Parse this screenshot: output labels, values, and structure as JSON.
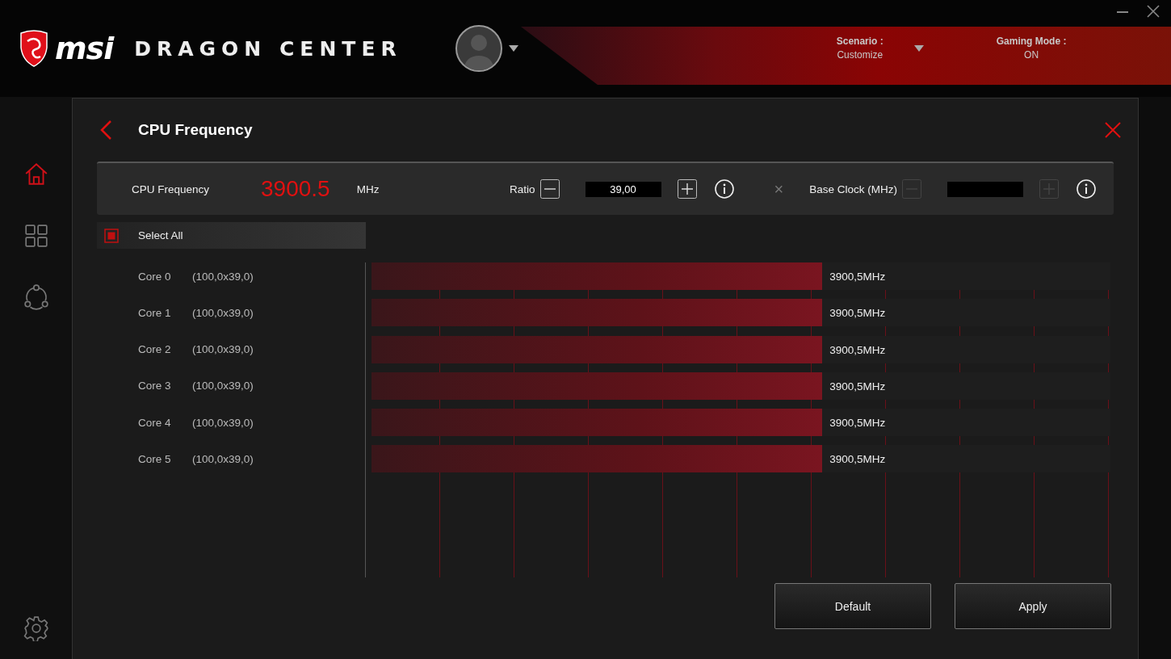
{
  "header": {
    "brand": "msi",
    "product": "DRAGON CENTER",
    "scenario": {
      "label": "Scenario :",
      "value": "Customize"
    },
    "gaming_mode": {
      "label": "Gaming Mode :",
      "value": "ON"
    }
  },
  "sidebar": {
    "items": [
      {
        "kind": "home",
        "selected": true
      },
      {
        "kind": "apps",
        "selected": false
      },
      {
        "kind": "share",
        "selected": false
      },
      {
        "kind": "settings",
        "selected": false
      }
    ]
  },
  "panel": {
    "title": "CPU Frequency",
    "control_bar": {
      "label": "CPU Frequency",
      "value": "3900.5",
      "unit": "MHz",
      "ratio": {
        "label": "Ratio",
        "value": "39,00",
        "disabled": false
      },
      "times": "×",
      "base_clock": {
        "label": "Base Clock (MHz)",
        "disabled": true
      }
    },
    "select_all": {
      "label": "Select All",
      "checked": true
    },
    "cores": [
      {
        "name": "Core 0",
        "multiplier": "(100,0x39,0)",
        "level": 0.61,
        "reading": "3900,5MHz"
      },
      {
        "name": "Core 1",
        "multiplier": "(100,0x39,0)",
        "level": 0.61,
        "reading": "3900,5MHz"
      },
      {
        "name": "Core 2",
        "multiplier": "(100,0x39,0)",
        "level": 0.61,
        "reading": "3900,5MHz"
      },
      {
        "name": "Core 3",
        "multiplier": "(100,0x39,0)",
        "level": 0.61,
        "reading": "3900,5MHz"
      },
      {
        "name": "Core 4",
        "multiplier": "(100,0x39,0)",
        "level": 0.61,
        "reading": "3900,5MHz"
      },
      {
        "name": "Core 5",
        "multiplier": "(100,0x39,0)",
        "level": 0.61,
        "reading": "3900,5MHz"
      }
    ],
    "buttons": [
      "Default",
      "Apply"
    ]
  }
}
